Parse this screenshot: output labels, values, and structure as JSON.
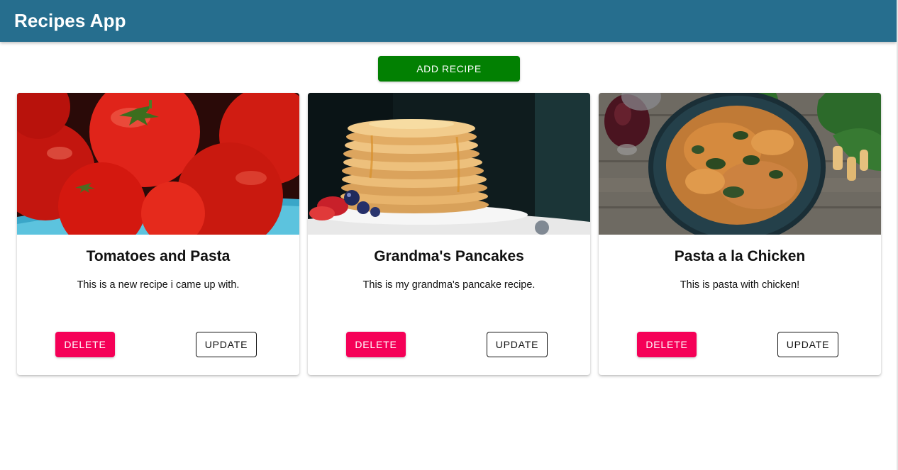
{
  "app": {
    "title": "Recipes App"
  },
  "actions": {
    "add_recipe_label": "ADD RECIPE"
  },
  "colors": {
    "appbar": "#266e8e",
    "add_button": "#028002",
    "delete_button": "#f50057"
  },
  "recipes": [
    {
      "image": "tomatoes-photo",
      "title": "Tomatoes and Pasta",
      "description": "This is a new recipe i came up with.",
      "delete_label": "DELETE",
      "update_label": "UPDATE"
    },
    {
      "image": "pancakes-photo",
      "title": "Grandma's Pancakes",
      "description": "This is my grandma's pancake recipe.",
      "delete_label": "DELETE",
      "update_label": "UPDATE"
    },
    {
      "image": "pasta-photo",
      "title": "Pasta a la Chicken",
      "description": "This is pasta with chicken!",
      "delete_label": "DELETE",
      "update_label": "UPDATE"
    }
  ]
}
